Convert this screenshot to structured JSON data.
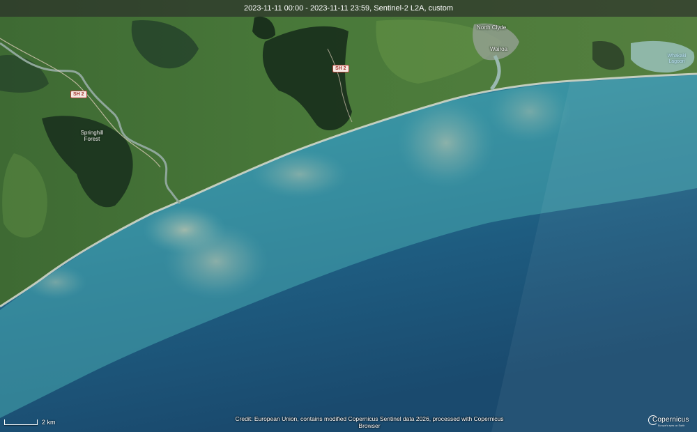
{
  "title": "2023-11-11 00:00 - 2023-11-11 23:59, Sentinel-2 L2A, custom",
  "roads": [
    {
      "label": "SH 2"
    },
    {
      "label": "SH 2"
    }
  ],
  "places": {
    "north_clyde": "North Clyde",
    "wairoa": "Wairoa",
    "springhill_forest_line1": "Springhill",
    "springhill_forest_line2": "Forest",
    "whakaki_lagoon_line1": "Whakaki",
    "whakaki_lagoon_line2": "Lagoon"
  },
  "scale": {
    "label": "2 km"
  },
  "credit": "Credit: European Union, contains modified Copernicus Sentinel data 2026, processed with Copernicus Browser",
  "logo": {
    "name": "copernicus-logo",
    "word": "Copernicus",
    "sub": "Europe's eyes on Earth"
  },
  "colors": {
    "land": "#3f6b35",
    "forest": "#1f3a22",
    "coast_water": "#3fa4ad",
    "deep_water": "#1a4a6e",
    "sediment": "#b7bfa6"
  }
}
